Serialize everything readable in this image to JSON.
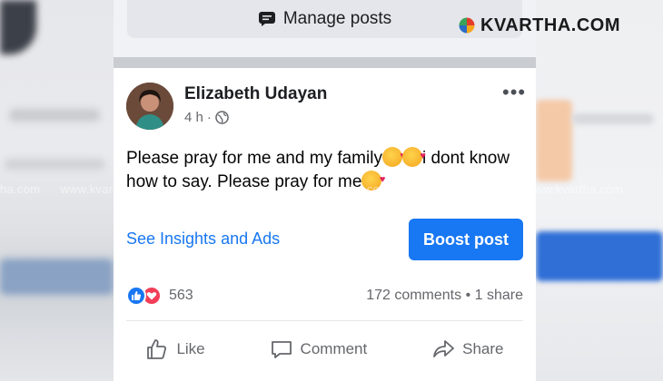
{
  "watermark": {
    "text": "www.kvartha.com",
    "partial_left": "ha.com"
  },
  "logo": {
    "text": "KVARTHA.COM"
  },
  "manage_bar": {
    "label": "Manage posts",
    "icon": "manage-posts-icon"
  },
  "post": {
    "author": "Elizabeth Udayan",
    "time": "4 h",
    "privacy_icon": "globe-icon",
    "more_icon": "more-options-icon",
    "text_part1": "Please pray for me and my family",
    "text_part2": "i dont know how to say. Please pray for me",
    "insights_label": "See Insights and Ads",
    "boost_label": "Boost post",
    "reaction_count": "563",
    "comments": "172 comments",
    "shares": "1 share",
    "actions": {
      "like": "Like",
      "comment": "Comment",
      "share": "Share"
    }
  },
  "colors": {
    "accent": "#1877f2",
    "love": "#f33e58"
  }
}
